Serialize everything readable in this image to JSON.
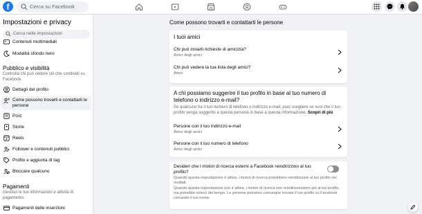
{
  "topbar": {
    "logo": "f",
    "search_placeholder": "Cerca su Facebook",
    "nav_icons": [
      "home-icon",
      "video-icon",
      "marketplace-icon",
      "groups-icon",
      "gaming-icon"
    ],
    "right_icons": [
      "menu-grid-icon",
      "messenger-icon",
      "notifications-icon",
      "account-avatar"
    ]
  },
  "sidebar": {
    "title": "Impostazioni e privacy",
    "search_placeholder": "Cerca nelle impostazioni",
    "top_items": [
      {
        "label": "Contenuti multimediali",
        "icon": "media-icon"
      },
      {
        "label": "Modalità sfondo nero",
        "icon": "moon-icon"
      }
    ],
    "section_public": {
      "title": "Pubblico e visibilità",
      "desc": "Controlla chi può vedere ciò che condividi su Facebook."
    },
    "public_items": [
      {
        "label": "Dettagli del profilo",
        "icon": "profile-icon"
      },
      {
        "label": "Come possono trovarti e contattarti le persone",
        "icon": "find-people-icon"
      },
      {
        "label": "Post",
        "icon": "post-icon"
      },
      {
        "label": "Storie",
        "icon": "stories-icon"
      },
      {
        "label": "Reels",
        "icon": "reels-icon"
      },
      {
        "label": "Follower e contenuti pubblici",
        "icon": "followers-icon"
      },
      {
        "label": "Profilo e aggiunta di tag",
        "icon": "tag-icon"
      },
      {
        "label": "Bloccare qualcuno",
        "icon": "block-icon"
      }
    ],
    "section_payments": {
      "title": "Pagamenti",
      "desc": "Gestisci le tue informazioni e attività di pagamento."
    },
    "payment_items": [
      {
        "label": "Pagamenti delle inserzioni",
        "icon": "card-icon"
      }
    ]
  },
  "main": {
    "title": "Come possono trovarti e contattarti le persone",
    "card1": {
      "title": "I tuoi amici",
      "rows": [
        {
          "question": "Chi può inviarti richieste di amicizia?",
          "answer": "Amici degli amici"
        },
        {
          "question": "Chi può vedere la tua lista degli amici?",
          "answer": "Amici"
        }
      ]
    },
    "card2": {
      "title": "A chi possiamo suggerire il tuo profilo in base al tuo numero di telefono o indirizzo e-mail?",
      "desc": "Se qualcuno ha il tuo numero di telefono o indirizzo e-mail, puoi scegliere se vuoi che il tuo profilo venga suggerito a questa persona in base a questa informazione.",
      "link": "Scopri di più",
      "rows": [
        {
          "question": "Persone con il tuo indirizzo e-mail",
          "answer": "Amici degli amici"
        },
        {
          "question": "Persone con il tuo numero di telefono",
          "answer": "Amici degli amici"
        }
      ]
    },
    "card3": {
      "title": "Desideri che i motori di ricerca esterni a Facebook reindirizzino al tuo profilo?",
      "desc1": "Quando questa impostazione è attiva, i motori di ricerca potrebbero reindirizzare al tuo profilo nei risultati.",
      "desc2": "Quando questa impostazione non è attiva, i motori di ricerca non reindirizzeranno più al tuo profilo, ma potrebbe volerci del tempo. Le persone potranno comunque trovare il tuo profilo su Facebook cercando il tuo nome.",
      "toggle_on": false
    }
  },
  "colors": {
    "brand": "#1877f2",
    "background": "#f0f2f5",
    "toggle_off": "#8a8d91"
  }
}
